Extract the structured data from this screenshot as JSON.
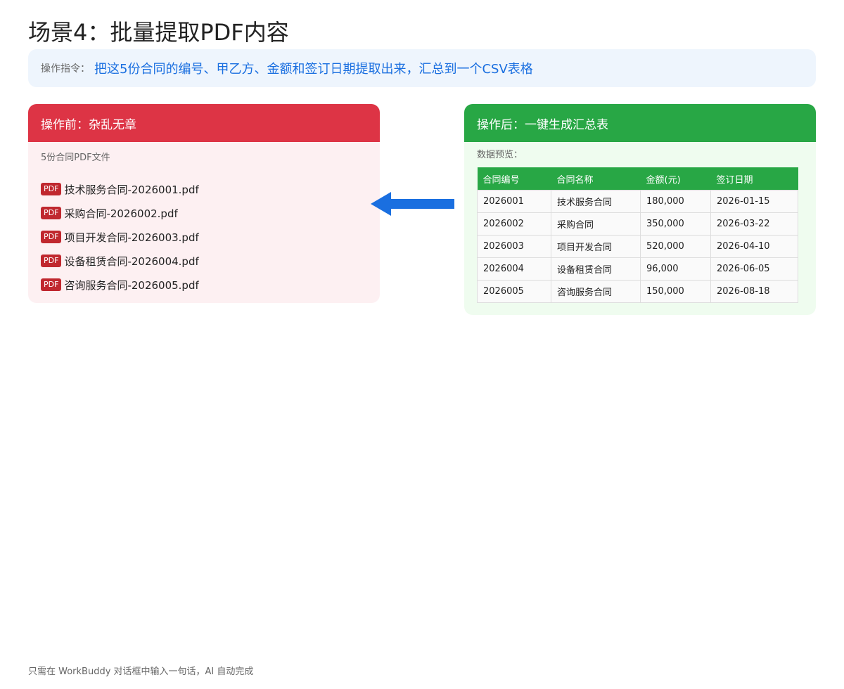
{
  "title": "场景4：批量提取PDF内容",
  "instruction": {
    "prefix": "操作指令：",
    "text": "把这5份合同的编号、甲乙方、金额和签订日期提取出来，汇总到一个CSV表格"
  },
  "before": {
    "header": "操作前：杂乱无章",
    "caption": "5份合同PDF文件",
    "badge": "PDF",
    "files": [
      "技术服务合同-2026001.pdf",
      "采购合同-2026002.pdf",
      "项目开发合同-2026003.pdf",
      "设备租赁合同-2026004.pdf",
      "咨询服务合同-2026005.pdf"
    ]
  },
  "after": {
    "header": "操作后：一键生成汇总表",
    "caption": "数据预览：",
    "table": {
      "columns": [
        "合同编号",
        "合同名称",
        "金额(元)",
        "签订日期"
      ],
      "rows": [
        [
          "2026001",
          "技术服务合同",
          "180,000",
          "2026-01-15"
        ],
        [
          "2026002",
          "采购合同",
          "350,000",
          "2026-03-22"
        ],
        [
          "2026003",
          "项目开发合同",
          "520,000",
          "2026-04-10"
        ],
        [
          "2026004",
          "设备租赁合同",
          "96,000",
          "2026-06-05"
        ],
        [
          "2026005",
          "咨询服务合同",
          "150,000",
          "2026-08-18"
        ]
      ]
    }
  },
  "arrow": {
    "icon": "arrow-left-icon",
    "color": "#1a6fe0"
  },
  "colors": {
    "before_accent": "#dd3445",
    "after_accent": "#28a745",
    "instruction_text": "#1a6fe0"
  },
  "footer": "只需在 WorkBuddy 对话框中输入一句话，AI 自动完成"
}
